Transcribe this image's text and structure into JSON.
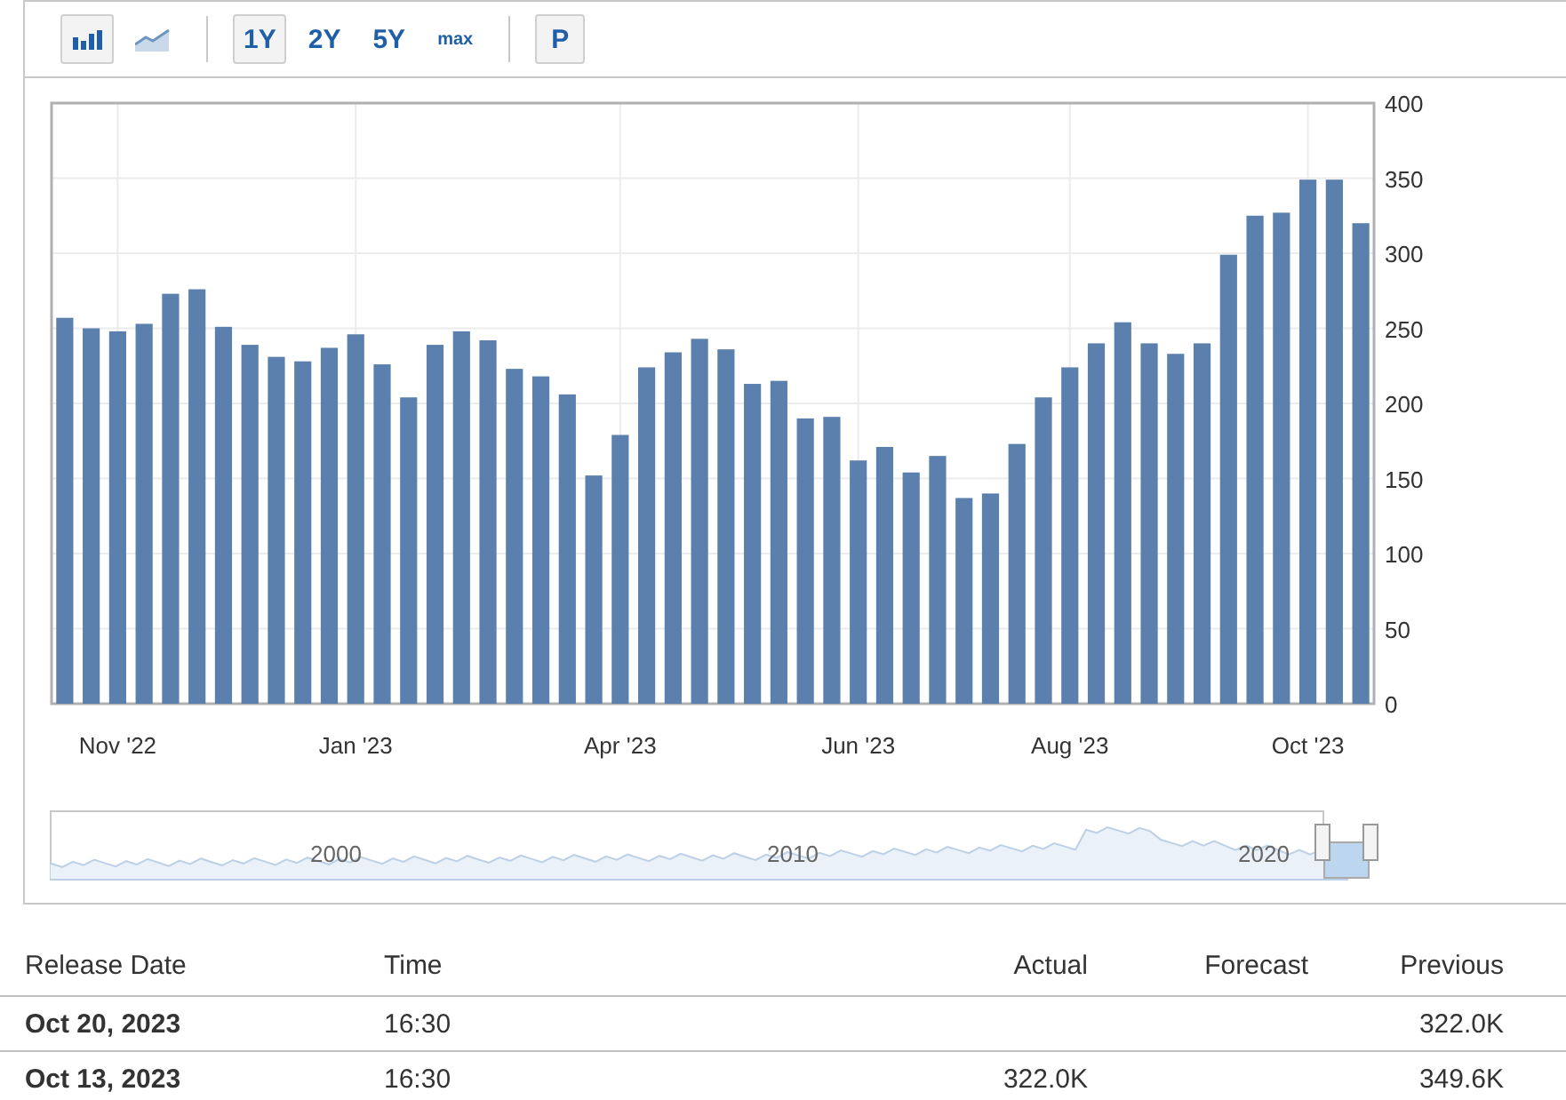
{
  "toolbar": {
    "chart_types": [
      {
        "kind": "bar",
        "selected": true
      },
      {
        "kind": "line",
        "selected": false
      }
    ],
    "ranges": [
      {
        "label": "1Y",
        "selected": true
      },
      {
        "label": "2Y",
        "selected": false
      },
      {
        "label": "5Y",
        "selected": false
      },
      {
        "label": "max",
        "selected": false
      }
    ],
    "extra_button": "P"
  },
  "chart_data": {
    "type": "bar",
    "color": "#5b80ad",
    "values": [
      257,
      250,
      248,
      253,
      273,
      276,
      251,
      239,
      231,
      228,
      237,
      246,
      226,
      204,
      239,
      248,
      242,
      223,
      218,
      206,
      152,
      179,
      224,
      234,
      243,
      236,
      213,
      215,
      190,
      191,
      162,
      171,
      154,
      165,
      137,
      140,
      173,
      204,
      224,
      240,
      254,
      240,
      233,
      240,
      299,
      325,
      327,
      349,
      349,
      320
    ],
    "categories": [
      null,
      null,
      "Nov '22",
      null,
      null,
      null,
      null,
      null,
      null,
      null,
      null,
      "Jan '23",
      null,
      null,
      null,
      null,
      null,
      null,
      null,
      null,
      null,
      "Apr '23",
      null,
      null,
      null,
      null,
      null,
      null,
      null,
      null,
      "Jun '23",
      null,
      null,
      null,
      null,
      null,
      null,
      null,
      "Aug '23",
      null,
      null,
      null,
      null,
      null,
      null,
      null,
      null,
      "Oct '23",
      null,
      null
    ],
    "grid": true,
    "ylim": [
      0,
      400
    ],
    "yticks": [
      0,
      50,
      100,
      150,
      200,
      250,
      300,
      350,
      400
    ]
  },
  "navigator": {
    "labels": [
      "2000",
      "2010",
      "2020"
    ]
  },
  "table": {
    "columns": [
      "Release Date",
      "Time",
      "Actual",
      "Forecast",
      "Previous"
    ],
    "rows": [
      {
        "release_date": "Oct 20, 2023",
        "time": "16:30",
        "previous": "322.0K"
      },
      {
        "release_date": "Oct 13, 2023",
        "time": "16:30",
        "actual": "322.0K",
        "previous": "349.6K"
      }
    ]
  }
}
